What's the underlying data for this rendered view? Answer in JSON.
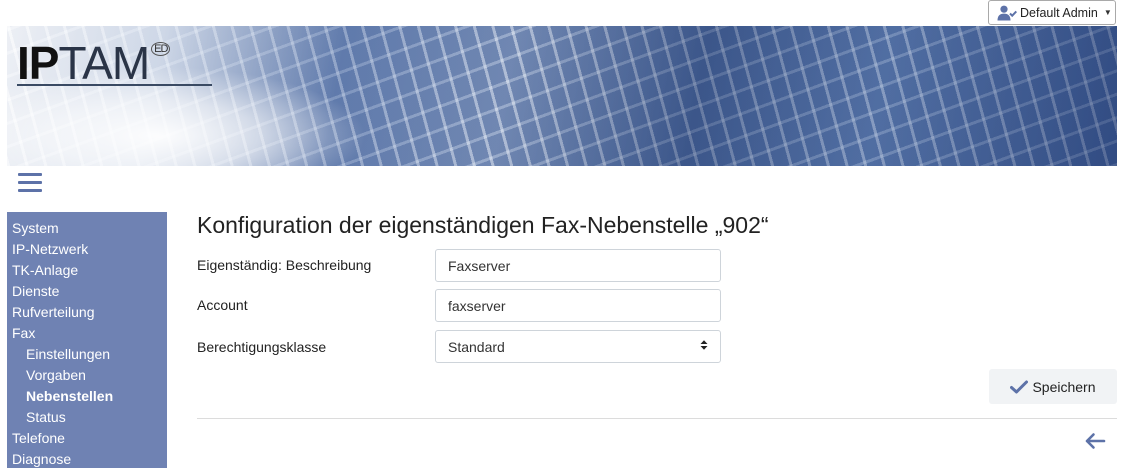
{
  "header": {
    "user_label": "Default Admin",
    "user_icon": "user-check-icon",
    "caret_icon": "caret-down-icon"
  },
  "banner": {
    "logo_bold": "IP",
    "logo_light": "TAM",
    "logo_mark": "ED"
  },
  "sidebar": {
    "items": [
      {
        "label": "System",
        "level": 0,
        "active": false
      },
      {
        "label": "IP-Netzwerk",
        "level": 0,
        "active": false
      },
      {
        "label": "TK-Anlage",
        "level": 0,
        "active": false
      },
      {
        "label": "Dienste",
        "level": 0,
        "active": false
      },
      {
        "label": "Rufverteilung",
        "level": 0,
        "active": false
      },
      {
        "label": "Fax",
        "level": 0,
        "active": false
      },
      {
        "label": "Einstellungen",
        "level": 1,
        "active": false
      },
      {
        "label": "Vorgaben",
        "level": 1,
        "active": false
      },
      {
        "label": "Nebenstellen",
        "level": 1,
        "active": true
      },
      {
        "label": "Status",
        "level": 1,
        "active": false
      },
      {
        "label": "Telefone",
        "level": 0,
        "active": false
      },
      {
        "label": "Diagnose",
        "level": 0,
        "active": false
      }
    ]
  },
  "main": {
    "title": "Konfiguration der eigenständigen Fax-Nebenstelle „902“",
    "fields": {
      "description": {
        "label": "Eigenständig: Beschreibung",
        "value": "Faxserver"
      },
      "account": {
        "label": "Account",
        "value": "faxserver"
      },
      "class": {
        "label": "Berechtigungsklasse",
        "value": "Standard"
      }
    },
    "save_label": "Speichern"
  },
  "colors": {
    "sidebar_bg": "#6f82b3",
    "accent": "#5d72a8"
  }
}
